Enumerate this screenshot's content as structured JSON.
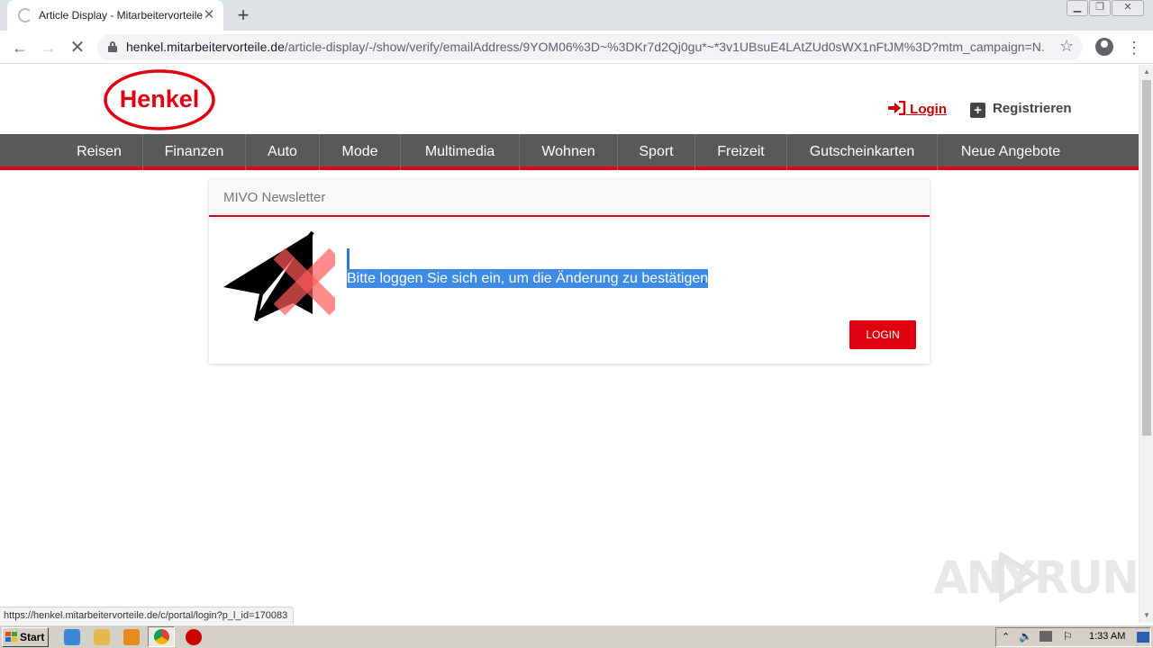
{
  "browser": {
    "tab_title": "Article Display - Mitarbeitervorteile",
    "new_tab_symbol": "+",
    "url_host": "henkel.mitarbeitervorteile.de",
    "url_path": "/article-display/-/show/verify/emailAddress/9YOM06%3D~%3DKr7d2Qj0gu*~*3v1UBsuE4LAtZUd0sWX1nFtJM%3D?mtm_campaign=N...",
    "status_url": "https://henkel.mitarbeitervorteile.de/c/portal/login?p_l_id=170083"
  },
  "header": {
    "logo_text": "Henkel",
    "login_label": "Login",
    "register_label": "Registrieren"
  },
  "nav": {
    "items": [
      "Reisen",
      "Finanzen",
      "Auto",
      "Mode",
      "Multimedia",
      "Wohnen",
      "Sport",
      "Freizeit",
      "Gutscheinkarten",
      "Neue Angebote"
    ]
  },
  "panel": {
    "title": "MIVO Newsletter",
    "message": "Bitte loggen Sie sich ein, um die Änderung zu bestätigen",
    "message_end": ".",
    "button_label": "LOGIN"
  },
  "watermark": {
    "left": "ANY",
    "right": "RUN"
  },
  "taskbar": {
    "start_label": "Start",
    "clock": "1:33 AM"
  },
  "colors": {
    "brand_red": "#e1000f",
    "nav_bg": "#58595b",
    "selection": "#3e8be6"
  },
  "icons": [
    "spinner-icon",
    "close-icon",
    "back-icon",
    "forward-icon",
    "stop-icon",
    "lock-icon",
    "star-icon",
    "profile-icon",
    "menu-icon",
    "login-icon",
    "plus-icon",
    "paper-plane-icon",
    "error-x-icon"
  ]
}
